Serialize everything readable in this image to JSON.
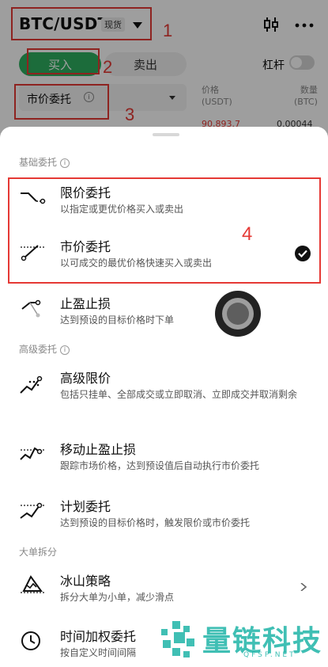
{
  "header": {
    "pair": "BTC/USDT",
    "badge": "现货"
  },
  "trade": {
    "buy_label": "买入",
    "sell_label": "卖出",
    "leverage_label": "杠杆",
    "order_type": "市价委托",
    "price_header": "价格\n(USDT)",
    "qty_header": "数量\n(BTC)",
    "price_value": "90,893.7",
    "qty_value": "0.00044"
  },
  "annotations": {
    "n1": "1",
    "n2": "2",
    "n3": "3",
    "n4": "4"
  },
  "sheet": {
    "section_basic": "基础委托",
    "section_advanced": "高级委托",
    "section_bulk": "大单拆分",
    "items": [
      {
        "title": "限价委托",
        "desc": "以指定或更优价格买入或卖出"
      },
      {
        "title": "市价委托",
        "desc": "以可成交的最优价格快速买入或卖出"
      },
      {
        "title": "止盈止损",
        "desc": "达到预设的目标价格时下单"
      },
      {
        "title": "高级限价",
        "desc": "包括只挂单、全部成交或立即取消、立即成交并取消剩余"
      },
      {
        "title": "移动止盈止损",
        "desc": "跟踪市场价格，达到预设值后自动执行市价委托"
      },
      {
        "title": "计划委托",
        "desc": "达到预设的目标价格时，触发限价或市价委托"
      },
      {
        "title": "冰山策略",
        "desc": "拆分大单为小单，减少滑点"
      },
      {
        "title": "时间加权委托",
        "desc": "按自定义时间间隔"
      }
    ]
  },
  "watermark": {
    "text": "量链科技",
    "sub": "QFSP.NET"
  }
}
